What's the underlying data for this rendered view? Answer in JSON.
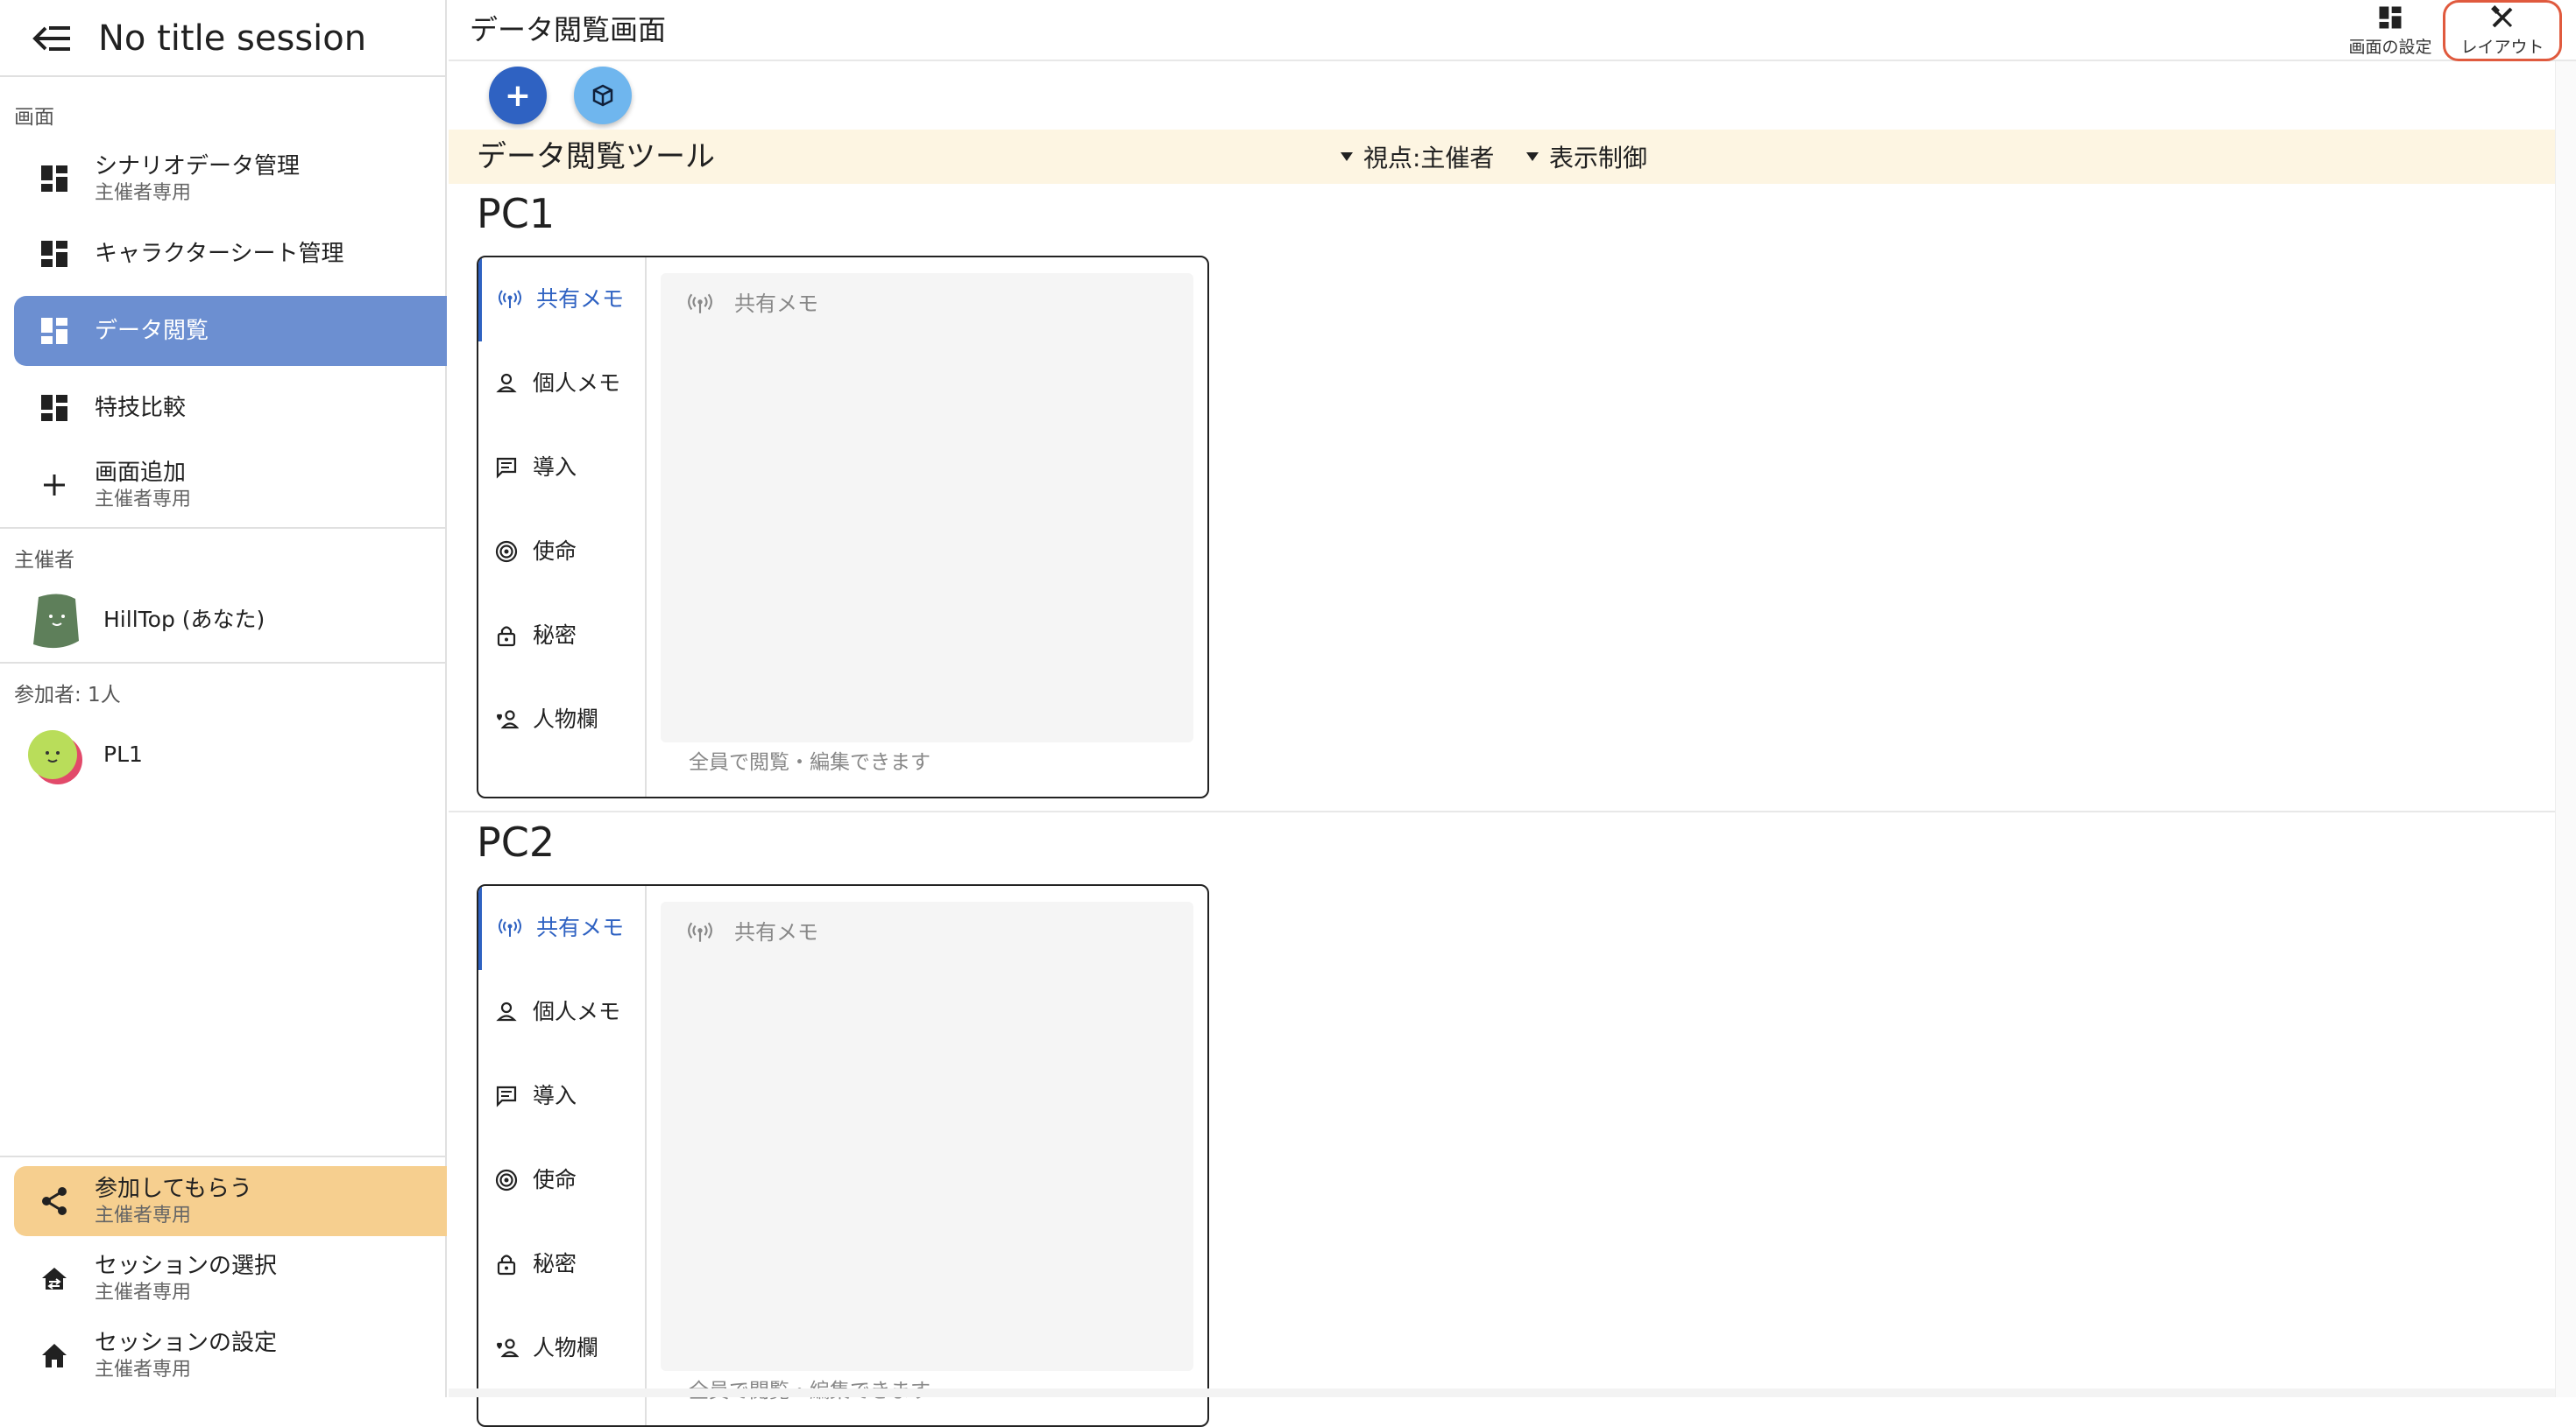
{
  "sidebar": {
    "session_title": "No title session",
    "section_screens": "画面",
    "items": [
      {
        "label": "シナリオデータ管理",
        "sub": "主催者専用"
      },
      {
        "label": "キャラクターシート管理",
        "sub": ""
      },
      {
        "label": "データ閲覧",
        "sub": ""
      },
      {
        "label": "特技比較",
        "sub": ""
      },
      {
        "label": "画面追加",
        "sub": "主催者専用"
      }
    ],
    "section_host": "主催者",
    "host_name": "HillTop (あなた)",
    "section_participants": "参加者: 1人",
    "participant_name": "PL1",
    "bottom_items": [
      {
        "label": "参加してもらう",
        "sub": "主催者専用"
      },
      {
        "label": "セッションの選択",
        "sub": "主催者専用"
      },
      {
        "label": "セッションの設定",
        "sub": "主催者専用"
      }
    ]
  },
  "header": {
    "title": "データ閲覧画面",
    "screen_settings_label": "画面の設定",
    "layout_label": "レイアウト"
  },
  "toolbar": {
    "title": "データ閲覧ツール",
    "viewpoint": "視点:主催者",
    "display_control": "表示制御"
  },
  "pcs": [
    {
      "name": "PC1",
      "tabs": [
        "共有メモ",
        "個人メモ",
        "導入",
        "使命",
        "秘密",
        "人物欄"
      ],
      "active_tab": "共有メモ",
      "memo_placeholder": "共有メモ",
      "memo_hint": "全員で閲覧・編集できます"
    },
    {
      "name": "PC2",
      "tabs": [
        "共有メモ",
        "個人メモ",
        "導入",
        "使命",
        "秘密",
        "人物欄"
      ],
      "active_tab": "共有メモ",
      "memo_placeholder": "共有メモ",
      "memo_hint": "全員で閲覧・編集できます"
    }
  ],
  "colors": {
    "accent": "#2f62c2",
    "active_nav": "#6c8fd1",
    "share_highlight": "#f6cf8f",
    "toolbar_bg": "#fdf5e2",
    "layout_outline": "#e05a3e"
  }
}
